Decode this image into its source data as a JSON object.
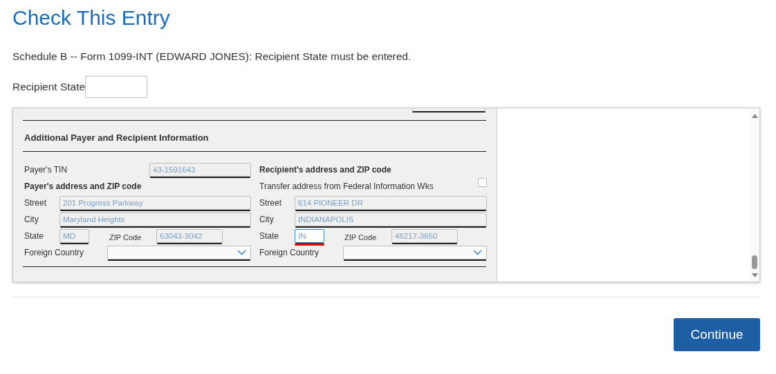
{
  "title": "Check This Entry",
  "message": "Schedule B -- Form 1099-INT (EDWARD JONES): Recipient State must be entered.",
  "recipient_state": {
    "label": "Recipient State"
  },
  "form": {
    "section_title": "Additional Payer and Recipient Information",
    "columns": [
      {
        "items": [
          {
            "kind": "id_field",
            "label": "Payer's TIN",
            "value": "43-1591643",
            "error": false
          },
          {
            "kind": "heading",
            "label": "Payer's address and ZIP code"
          },
          {
            "kind": "field",
            "label": "Street",
            "value": "201 Progress Parkway",
            "error": false
          },
          {
            "kind": "field",
            "label": "City",
            "value": "Maryland Heights",
            "error": false
          },
          {
            "kind": "state_zip",
            "label": "State",
            "value": "MO",
            "error": false,
            "zip_label": "ZIP Code",
            "zip_value": "63043-3042"
          },
          {
            "kind": "select",
            "label": "Foreign Country"
          }
        ]
      },
      {
        "items": [
          {
            "kind": "heading",
            "label": "Recipient's address and ZIP code"
          },
          {
            "kind": "checkbox",
            "label": "Transfer address from Federal Information Wks",
            "checked": false
          },
          {
            "kind": "field",
            "label": "Street",
            "value": "614 PIONEER DR",
            "error": false
          },
          {
            "kind": "field",
            "label": "City",
            "value": "INDIANAPOLIS",
            "error": false
          },
          {
            "kind": "state_zip",
            "label": "State",
            "value": "IN",
            "error": true,
            "zip_label": "ZIP Code",
            "zip_value": "46217-3650"
          },
          {
            "kind": "select",
            "label": "Foreign Country"
          }
        ]
      }
    ]
  },
  "continue_button": "Continue"
}
